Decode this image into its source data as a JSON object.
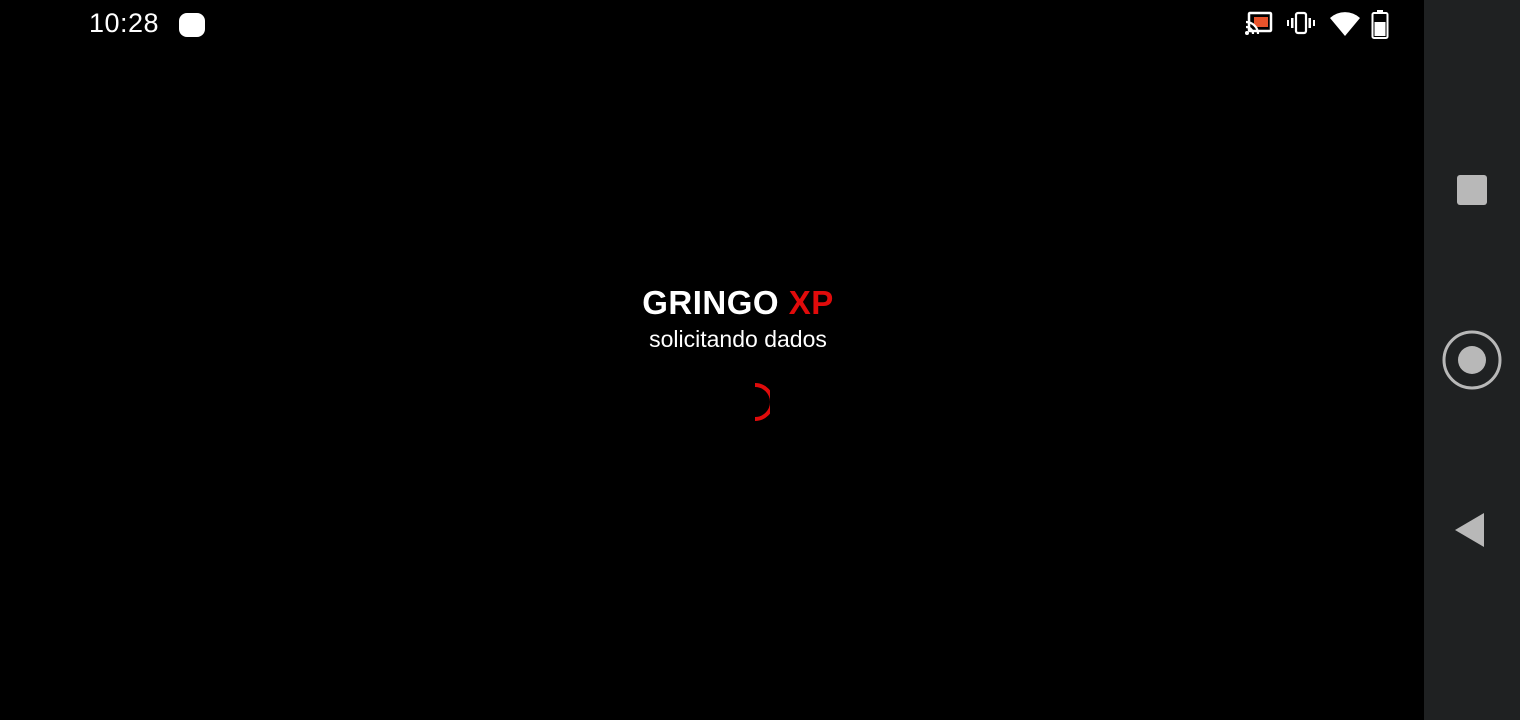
{
  "status_bar": {
    "time": "10:28",
    "icons": [
      "notification-dot-icon",
      "cast-icon",
      "vibrate-icon",
      "wifi-icon",
      "battery-icon"
    ]
  },
  "loading_screen": {
    "title_main": "GRINGO",
    "title_accent": "XP",
    "message": "solicitando dados"
  },
  "colors": {
    "background": "#000000",
    "accent": "#e00b0b",
    "text": "#ffffff",
    "nav_bar": "#1f2122",
    "nav_icon": "#b8b8b8"
  },
  "nav_bar": {
    "buttons": [
      "recents",
      "home",
      "back"
    ]
  }
}
